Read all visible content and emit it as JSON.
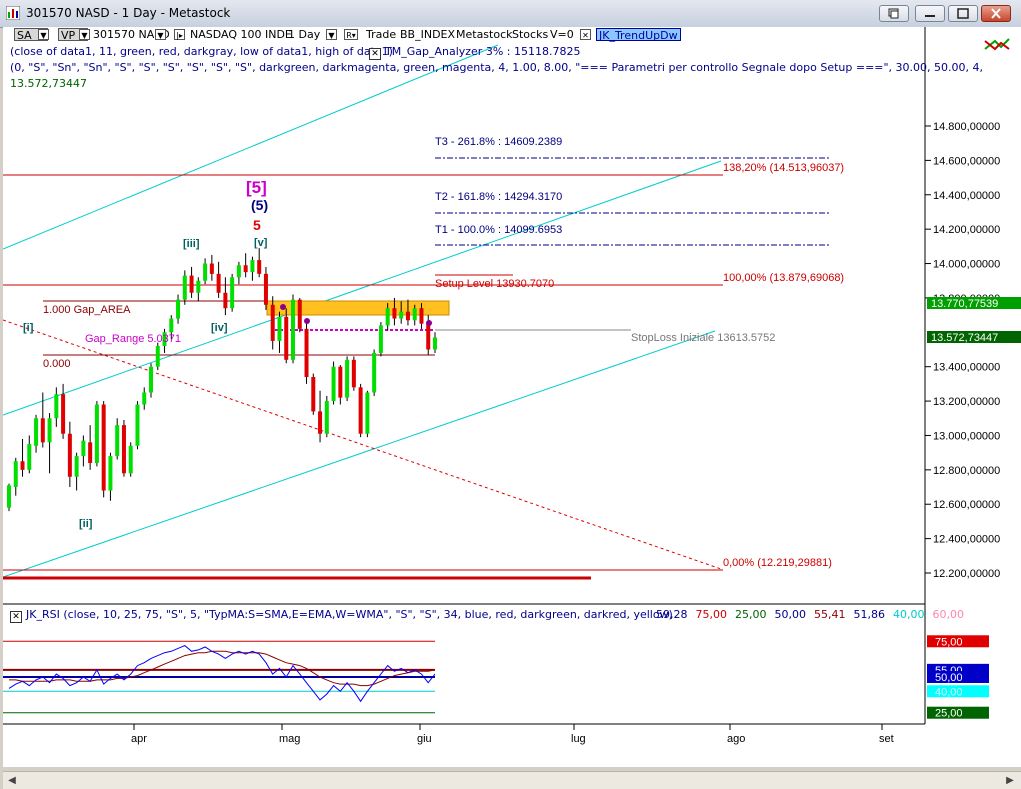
{
  "window": {
    "title": "301570 NASD - 1 Day - Metastock",
    "buttons": [
      "restore-down",
      "minimize",
      "maximize",
      "close"
    ]
  },
  "toolbar": {
    "sa": "SA",
    "vp": "VP",
    "symbol": "301570 NASD",
    "security": "NASDAQ 100 INDE",
    "period": "1 Day",
    "items": [
      "Trade",
      "BB_INDEX",
      "Metastock",
      "Stocks",
      "V=0"
    ],
    "trend_indicator": "JK_TrendUpDw"
  },
  "indicator_lines": {
    "line1": "(close of data1,  11,  green,  red,  darkgray,  low of data1,  high of data1)",
    "gap_analyzer": "TM_Gap_Analyzer 3% : 15118.7825",
    "line2": "(0,  \"S\",  \"Sn\",  \"Sn\",  \"S\",  \"S\",  \"S\",  \"S\",  \"S\",  \"S\",  darkgreen,  darkmagenta,  green,  magenta,  4,  1.00,  8.00,  \"=== Parametri per controllo Segnale dopo Setup ===\",  30.00,  50.00,  4,",
    "line3": "13.572,73447"
  },
  "chart_data": [
    {
      "type": "candlestick",
      "instrument": "301570 NASD",
      "y_axis": {
        "ticks": [
          "14.800,00000",
          "14.600,00000",
          "14.400,00000",
          "14.200,00000",
          "14.000,00000",
          "13.800,00000",
          "13.400,00000",
          "13.200,00000",
          "13.000,00000",
          "12.800,00000",
          "12.600,00000",
          "12.400,00000",
          "12.200,00000"
        ],
        "tick_values": [
          14800,
          14600,
          14400,
          14200,
          14000,
          13800,
          13400,
          13200,
          13000,
          12800,
          12600,
          12400,
          12200
        ],
        "ylim": [
          12100,
          15000
        ]
      },
      "x_axis": {
        "ticks": [
          "apr",
          "mag",
          "giu",
          "lug",
          "ago",
          "set"
        ]
      },
      "candles_approx": [
        [
          12580,
          12720,
          12560,
          12710
        ],
        [
          12700,
          12870,
          12650,
          12850
        ],
        [
          12850,
          12980,
          12760,
          12800
        ],
        [
          12800,
          13000,
          12780,
          12950
        ],
        [
          12940,
          13120,
          12900,
          13100
        ],
        [
          13100,
          13250,
          12930,
          12960
        ],
        [
          12960,
          13130,
          12780,
          13100
        ],
        [
          13100,
          13280,
          13050,
          13240
        ],
        [
          13240,
          13300,
          12980,
          13010
        ],
        [
          13010,
          13080,
          12700,
          12760
        ],
        [
          12760,
          12900,
          12680,
          12880
        ],
        [
          12880,
          13000,
          12820,
          12970
        ],
        [
          12960,
          13060,
          12800,
          12840
        ],
        [
          12840,
          13200,
          12820,
          13180
        ],
        [
          13180,
          13200,
          12640,
          12680
        ],
        [
          12680,
          12900,
          12620,
          12880
        ],
        [
          12880,
          13100,
          12860,
          13060
        ],
        [
          13060,
          13090,
          12760,
          12780
        ],
        [
          12780,
          12960,
          12760,
          12940
        ],
        [
          12940,
          13200,
          12920,
          13180
        ],
        [
          13180,
          13280,
          13150,
          13250
        ],
        [
          13250,
          13420,
          13220,
          13400
        ],
        [
          13400,
          13540,
          13380,
          13520
        ],
        [
          13520,
          13620,
          13480,
          13600
        ],
        [
          13600,
          13700,
          13560,
          13680
        ],
        [
          13680,
          13820,
          13650,
          13790
        ],
        [
          13790,
          13960,
          13760,
          13930
        ],
        [
          13930,
          13980,
          13800,
          13830
        ],
        [
          13830,
          13920,
          13780,
          13900
        ],
        [
          13900,
          14030,
          13880,
          14000
        ],
        [
          14000,
          14050,
          13900,
          13940
        ],
        [
          13940,
          14010,
          13800,
          13830
        ],
        [
          13830,
          13920,
          13700,
          13740
        ],
        [
          13740,
          13940,
          13720,
          13920
        ],
        [
          13920,
          14010,
          13880,
          13990
        ],
        [
          13990,
          14060,
          13920,
          13950
        ],
        [
          13950,
          14040,
          13900,
          14020
        ],
        [
          14020,
          14090,
          13920,
          13940
        ],
        [
          13940,
          13980,
          13730,
          13760
        ],
        [
          13760,
          13810,
          13500,
          13550
        ],
        [
          13550,
          13720,
          13480,
          13690
        ],
        [
          13690,
          13740,
          13420,
          13440
        ],
        [
          13440,
          13820,
          13420,
          13790
        ],
        [
          13790,
          13800,
          13600,
          13620
        ],
        [
          13620,
          13660,
          13300,
          13340
        ],
        [
          13340,
          13360,
          13120,
          13140
        ],
        [
          13140,
          13260,
          12960,
          13010
        ],
        [
          13010,
          13230,
          12990,
          13200
        ],
        [
          13200,
          13430,
          13180,
          13400
        ],
        [
          13400,
          13410,
          13180,
          13220
        ],
        [
          13220,
          13460,
          13200,
          13440
        ],
        [
          13440,
          13460,
          13260,
          13280
        ],
        [
          13280,
          13300,
          12990,
          13010
        ],
        [
          13010,
          13260,
          12990,
          13250
        ],
        [
          13250,
          13500,
          13230,
          13480
        ],
        [
          13480,
          13660,
          13460,
          13640
        ],
        [
          13640,
          13770,
          13610,
          13740
        ],
        [
          13740,
          13800,
          13640,
          13680
        ],
        [
          13680,
          13780,
          13650,
          13720
        ],
        [
          13720,
          13790,
          13640,
          13670
        ],
        [
          13670,
          13760,
          13640,
          13740
        ],
        [
          13740,
          13770,
          13620,
          13650
        ],
        [
          13650,
          13700,
          13470,
          13500
        ],
        [
          13500,
          13600,
          13480,
          13570
        ]
      ],
      "annotations": {
        "gap_area": "1.000 Gap_AREA",
        "gap_range": "Gap_Range 5.0371",
        "zero_label": "0.000",
        "setup_level": "Setup Level 13930.7070",
        "stoploss": "StopLoss Iniziale 13613.5752",
        "targets": [
          {
            "label": "T3 - 261.8% : 14609.2389",
            "value": 14609.2389
          },
          {
            "label": "T2 - 161.8% : 14294.3170",
            "value": 14294.317
          },
          {
            "label": "T1 - 100.0% : 14099.6953",
            "value": 14099.6953
          }
        ],
        "fib_levels": [
          {
            "label": "138,20% (14.513,96037)",
            "value": 14513.96037
          },
          {
            "label": "100,00% (13.879,69068)",
            "value": 13879.69068
          },
          {
            "label": "0,00% (12.219,29881)",
            "value": 12219.29881
          }
        ],
        "wave_labels": [
          "[5]",
          "(5)",
          "5",
          "[v]",
          "[iii]",
          "[iv]",
          "[i]",
          "[ii]"
        ],
        "price_labels": [
          {
            "text": "13.770,77539",
            "color": "#00a000"
          },
          {
            "text": "13.572,73447",
            "color": "#006400"
          }
        ]
      }
    },
    {
      "type": "line",
      "name": "JK_RSI",
      "header": "(close,  10,  25,  75,  \"S\",  5,  \"TypMA:S=SMA,E=EMA,W=WMA\",  \"S\",  \"S\",  34,  blue,  red,  darkgreen,  darkred,  yellow)",
      "readouts": [
        {
          "text": "59,28",
          "color": "#00008b"
        },
        {
          "text": "75,00",
          "color": "#cc0000"
        },
        {
          "text": "25,00",
          "color": "#006400"
        },
        {
          "text": "50,00",
          "color": "#00008b"
        },
        {
          "text": "55,41",
          "color": "#8b0000"
        },
        {
          "text": "51,86",
          "color": "#00008b"
        },
        {
          "text": "40,00",
          "color": "#00cccc"
        },
        {
          "text": "60,00",
          "color": "#ff88aa"
        }
      ],
      "y_labels": [
        {
          "text": "75,00",
          "color": "#e00000"
        },
        {
          "text": "55,00",
          "color": "#0000c8"
        },
        {
          "text": "50,00",
          "color": "#0000c8"
        },
        {
          "text": "40,00",
          "color": "#00ffff"
        },
        {
          "text": "25,00",
          "color": "#006400"
        }
      ],
      "ylim": [
        15,
        85
      ]
    }
  ]
}
